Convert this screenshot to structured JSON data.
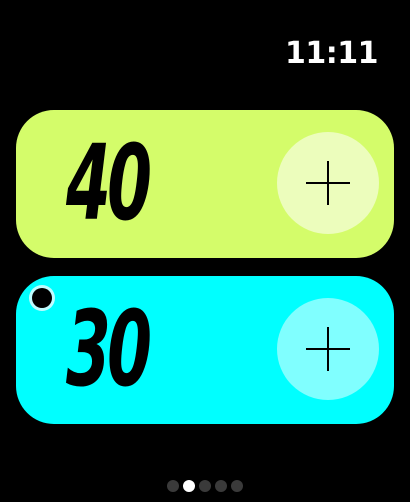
{
  "status_bar": {
    "time": "11:11"
  },
  "scoreboard": {
    "home": {
      "score": "40",
      "color": "#d4fc6a",
      "button_color": "#ecfdbc",
      "button_icon": "plus-icon"
    },
    "away": {
      "score": "30",
      "color": "#00ffff",
      "button_color": "#80ffff",
      "button_icon": "plus-icon",
      "serving": true
    }
  },
  "pager": {
    "total_pages": 5,
    "active_page": 2
  }
}
